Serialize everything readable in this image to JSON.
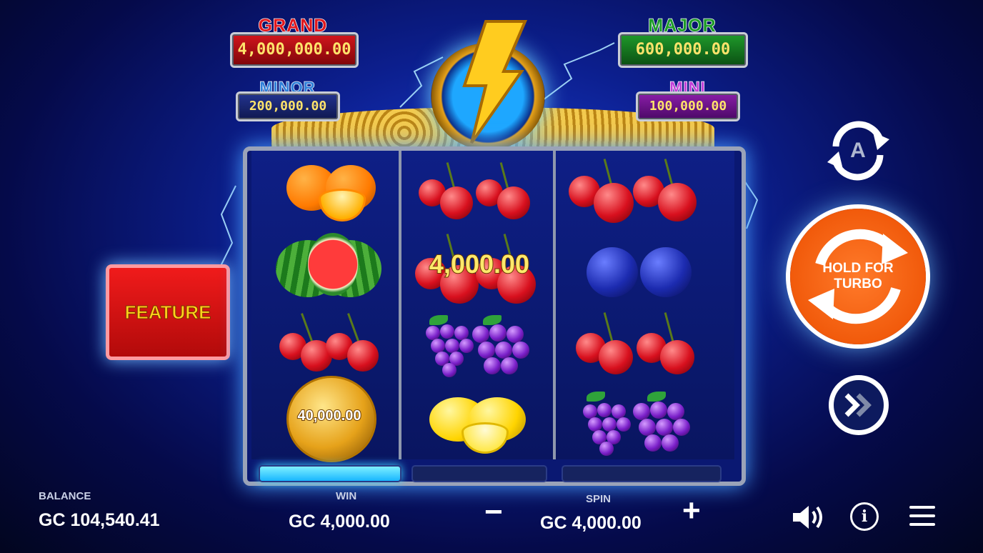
{
  "jackpots": {
    "grand": {
      "title": "GRAND",
      "value": "4,000,000.00"
    },
    "major": {
      "title": "MAJOR",
      "value": "600,000.00"
    },
    "minor": {
      "title": "MINOR",
      "value": "200,000.00"
    },
    "mini": {
      "title": "MINI",
      "value": "100,000.00"
    }
  },
  "feature_button": {
    "label": "FEATURE"
  },
  "reels": [
    {
      "symbols": [
        "orange",
        "watermelon",
        "cherry",
        "coin"
      ],
      "coin_value": "40,000.00"
    },
    {
      "symbols": [
        "cherry",
        "cherry",
        "grapes",
        "lemon"
      ],
      "win_value": "4,000.00"
    },
    {
      "symbols": [
        "cherry",
        "plum",
        "cherry",
        "grapes"
      ]
    }
  ],
  "spin_button": {
    "label": "HOLD FOR TURBO",
    "icon": "spin-arrows-icon"
  },
  "autoplay_button": {
    "letter": "A",
    "icon": "autoplay-icon"
  },
  "fast_button": {
    "icon": "fast-forward-icon"
  },
  "progress": {
    "filled_segments": 1,
    "total_segments": 3
  },
  "bottom_bar": {
    "balance_label": "BALANCE",
    "balance_value": "GC 104,540.41",
    "win_label": "WIN",
    "win_value": "GC 4,000.00",
    "spin_label": "SPIN",
    "spin_value": "GC 4,000.00",
    "minus_label": "−",
    "plus_label": "+"
  },
  "icons": {
    "sound": "speaker-icon",
    "info": "info-icon",
    "menu": "hamburger-menu-icon",
    "logo": "lightning-bolt-icon"
  },
  "colors": {
    "grand": "#e0171e",
    "major": "#1e9b2a",
    "minor": "#2f7fd9",
    "mini": "#c23fd8",
    "spin": "#ff6a1a",
    "feature": "#e81010"
  }
}
